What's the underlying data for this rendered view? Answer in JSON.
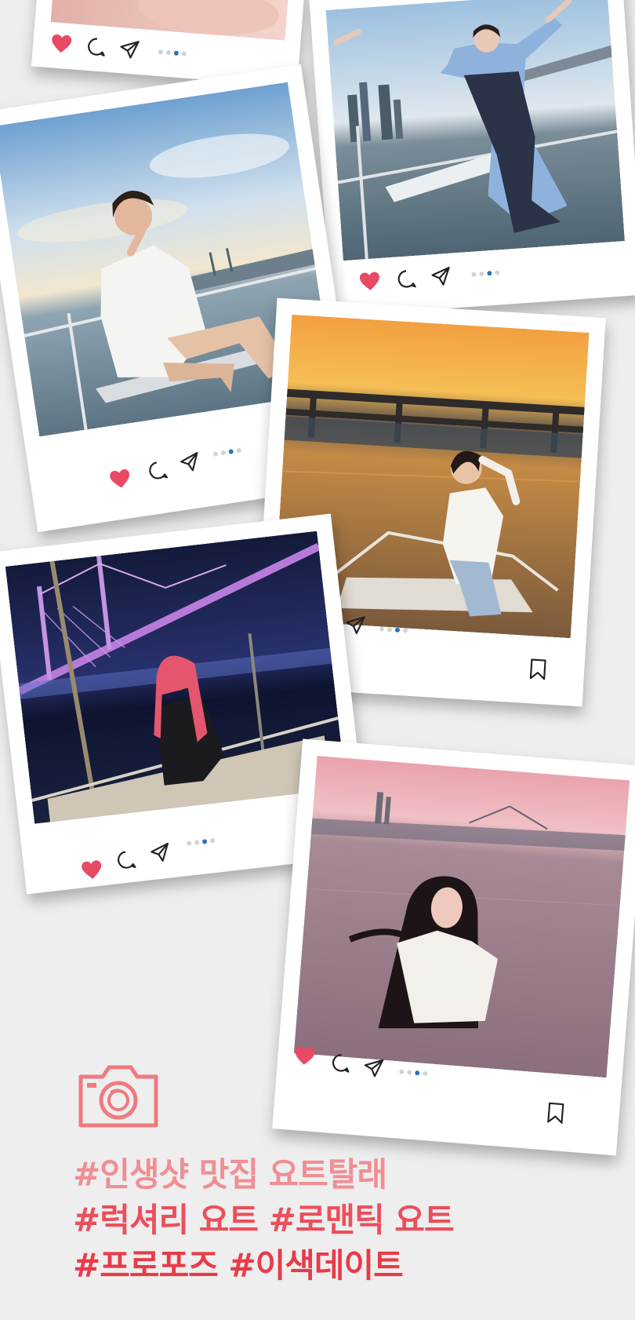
{
  "colors": {
    "background": "#eeeeee",
    "heart": "#e84a63",
    "active_dot": "#2b74b8",
    "inactive_dot": "#cfd3d8",
    "hashtag_line1": "#f08e94",
    "hashtag_line2": "#eb4f5c",
    "hashtag_line3": "#e83b4a",
    "camera_icon": "#ef7a7f"
  },
  "posts": [
    {
      "id": "partial-top",
      "scene": "pink-fabric",
      "icons": [
        "heart-icon",
        "comment-icon",
        "share-icon"
      ],
      "carousel": {
        "count": 4,
        "active": 2
      },
      "bookmark": false
    },
    {
      "id": "arms-up-bridge",
      "scene": "day-bay-skyline",
      "icons": [
        "heart-icon",
        "comment-icon",
        "share-icon"
      ],
      "carousel": {
        "count": 4,
        "active": 2
      },
      "bookmark": false
    },
    {
      "id": "white-dress-sunset",
      "scene": "cloudy-sky-bridge",
      "icons": [
        "heart-icon",
        "comment-icon",
        "share-icon"
      ],
      "carousel": {
        "count": 4,
        "active": 2
      },
      "bookmark": false
    },
    {
      "id": "golden-hour-bridge",
      "scene": "orange-sunset-bridge",
      "icons": [
        "heart-icon",
        "comment-icon",
        "share-icon"
      ],
      "carousel": {
        "count": 4,
        "active": 2
      },
      "bookmark": true
    },
    {
      "id": "night-bridge-lights",
      "scene": "night-illuminated-bridge",
      "icons": [
        "heart-icon",
        "comment-icon",
        "share-icon"
      ],
      "carousel": {
        "count": 4,
        "active": 2
      },
      "bookmark": true
    },
    {
      "id": "pink-sky-wind",
      "scene": "pink-dusk-sea",
      "icons": [
        "heart-icon",
        "comment-icon",
        "share-icon"
      ],
      "carousel": {
        "count": 4,
        "active": 2
      },
      "bookmark": true
    }
  ],
  "camera_icon": "camera-icon",
  "hashtags": [
    "#인생샷 맛집 요트탈래",
    "#럭셔리 요트 #로맨틱 요트",
    "#프로포즈 #이색데이트"
  ]
}
